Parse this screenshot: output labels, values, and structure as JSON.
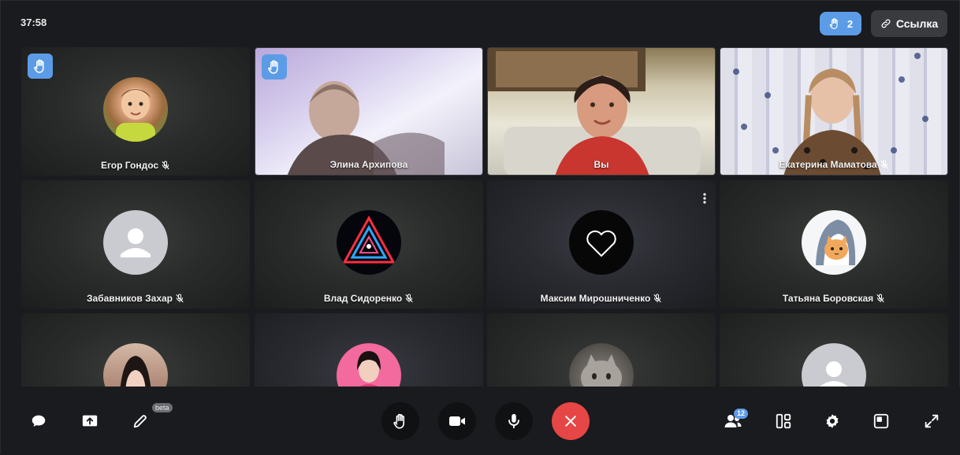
{
  "timer": "37:58",
  "raised_hands_count": "2",
  "link_button_label": "Ссылка",
  "participants": [
    {
      "name": "Егор Гондос",
      "muted": true,
      "hand_raised": true,
      "kind": "avatar-photo"
    },
    {
      "name": "Элина Архипова",
      "muted": false,
      "hand_raised": true,
      "kind": "video"
    },
    {
      "name": "Вы",
      "muted": false,
      "hand_raised": false,
      "kind": "video"
    },
    {
      "name": "Екатерина Маматова",
      "muted": true,
      "hand_raised": false,
      "kind": "video"
    },
    {
      "name": "Забавников Захар",
      "muted": true,
      "hand_raised": false,
      "kind": "avatar-default"
    },
    {
      "name": "Влад Сидоренко",
      "muted": true,
      "hand_raised": false,
      "kind": "avatar-neon"
    },
    {
      "name": "Максим Мирошниченко",
      "muted": true,
      "hand_raised": false,
      "kind": "avatar-heart"
    },
    {
      "name": "Татьяна Боровская",
      "muted": true,
      "hand_raised": false,
      "kind": "avatar-cat"
    },
    {
      "name": "",
      "muted": false,
      "hand_raised": false,
      "kind": "avatar-photo"
    },
    {
      "name": "",
      "muted": false,
      "hand_raised": false,
      "kind": "avatar-photo"
    },
    {
      "name": "",
      "muted": false,
      "hand_raised": false,
      "kind": "avatar-photo"
    },
    {
      "name": "",
      "muted": false,
      "hand_raised": false,
      "kind": "avatar-default"
    }
  ],
  "toolbar": {
    "beta_label": "beta",
    "participants_count": "12"
  },
  "colors": {
    "accent": "#5c9ce6",
    "end_call": "#e64646",
    "background": "#1a1b1e"
  },
  "icons": [
    "chat-icon",
    "share-screen-icon",
    "pencil-icon",
    "raise-hand-icon",
    "camera-icon",
    "microphone-icon",
    "hang-up-icon",
    "participants-icon",
    "layout-icon",
    "settings-icon",
    "picture-in-picture-icon",
    "fullscreen-icon"
  ]
}
